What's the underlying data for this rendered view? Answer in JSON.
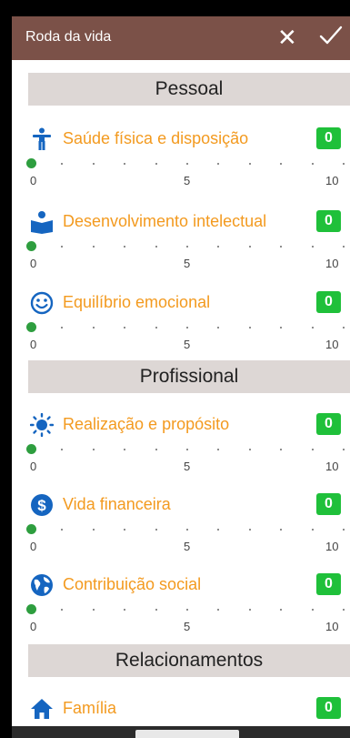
{
  "app": {
    "title": "Roda da vida",
    "colors": {
      "appbar": "#7b5148",
      "label": "#f39a1f",
      "badge": "#1fc03a",
      "thumb": "#2e9e3f",
      "section": "#ddd7d5"
    }
  },
  "scale": {
    "min": "0",
    "mid": "5",
    "max": "10"
  },
  "sections": [
    {
      "title": "Pessoal",
      "items": [
        {
          "label": "Saúde física e disposição",
          "value": "0",
          "icon": "person-standing-icon"
        },
        {
          "label": "Desenvolvimento intelectual",
          "value": "0",
          "icon": "book-reader-icon"
        },
        {
          "label": "Equilíbrio emocional",
          "value": "0",
          "icon": "smiley-face-icon"
        }
      ]
    },
    {
      "title": "Profissional",
      "items": [
        {
          "label": "Realização e propósito",
          "value": "0",
          "icon": "sun-icon"
        },
        {
          "label": "Vida financeira",
          "value": "0",
          "icon": "dollar-coin-icon"
        },
        {
          "label": "Contribuição social",
          "value": "0",
          "icon": "globe-icon"
        }
      ]
    },
    {
      "title": "Relacionamentos",
      "items": [
        {
          "label": "Família",
          "value": "0",
          "icon": "home-icon"
        }
      ]
    }
  ]
}
